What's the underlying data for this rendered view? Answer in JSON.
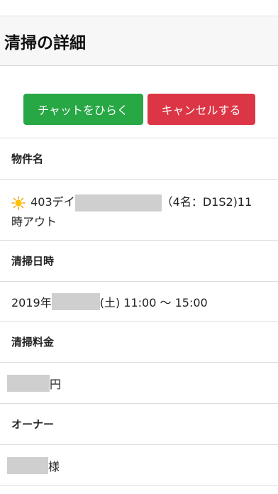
{
  "header": {
    "title": "清掃の詳細"
  },
  "actions": {
    "chat_label": "チャットをひらく",
    "cancel_label": "キャンセルする"
  },
  "colors": {
    "chat": "#28a745",
    "cancel": "#dc3545"
  },
  "fields": {
    "property": {
      "label": "物件名",
      "icon": "sun-icon",
      "value_prefix": "403デイ",
      "value_suffix": "（4名：D1S2)11",
      "value_line2": "時アウト"
    },
    "datetime": {
      "label": "清掃日時",
      "value_prefix": "2019年",
      "value_suffix": "(土) 11:00 〜 15:00"
    },
    "fee": {
      "label": "清掃料金",
      "value_suffix": "円"
    },
    "owner": {
      "label": "オーナー",
      "value_suffix": "様"
    }
  }
}
